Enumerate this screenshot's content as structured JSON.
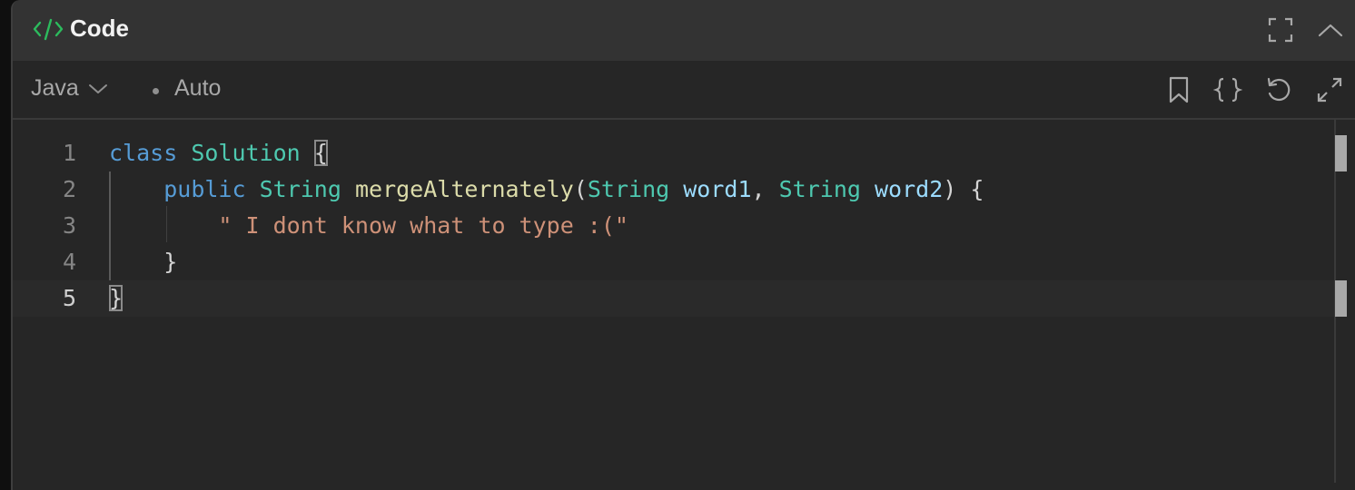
{
  "panel": {
    "title": "Code",
    "title_icon": "code-brackets-icon",
    "accent_color": "#2cbb5d",
    "actions": [
      {
        "name": "fullscreen-button",
        "icon": "fullscreen-corners-icon"
      },
      {
        "name": "collapse-button",
        "icon": "chevron-up-icon"
      }
    ]
  },
  "toolbar": {
    "language": "Java",
    "language_dropdown_icon": "chevron-down-icon",
    "mode": "Auto",
    "actions": [
      {
        "name": "bookmark-button",
        "icon": "bookmark-icon"
      },
      {
        "name": "format-code-button",
        "icon": "curly-braces-icon"
      },
      {
        "name": "reset-code-button",
        "icon": "undo-icon"
      },
      {
        "name": "expand-editor-button",
        "icon": "expand-arrows-icon"
      }
    ]
  },
  "editor": {
    "active_line": 5,
    "lines": [
      {
        "number": "1",
        "tokens": [
          {
            "t": "class",
            "c": "kw"
          },
          {
            "t": " ",
            "c": "pn"
          },
          {
            "t": "Solution",
            "c": "ty"
          },
          {
            "t": " ",
            "c": "pn"
          },
          {
            "t": "{",
            "c": "pn brk"
          }
        ]
      },
      {
        "number": "2",
        "tokens": [
          {
            "t": "    ",
            "c": "pn"
          },
          {
            "t": "public",
            "c": "kw"
          },
          {
            "t": " ",
            "c": "pn"
          },
          {
            "t": "String",
            "c": "ty"
          },
          {
            "t": " ",
            "c": "pn"
          },
          {
            "t": "mergeAlternately",
            "c": "fn"
          },
          {
            "t": "(",
            "c": "pn"
          },
          {
            "t": "String",
            "c": "ty"
          },
          {
            "t": " ",
            "c": "pn"
          },
          {
            "t": "word1",
            "c": "pr"
          },
          {
            "t": ", ",
            "c": "pn"
          },
          {
            "t": "String",
            "c": "ty"
          },
          {
            "t": " ",
            "c": "pn"
          },
          {
            "t": "word2",
            "c": "pr"
          },
          {
            "t": ") {",
            "c": "pn"
          }
        ]
      },
      {
        "number": "3",
        "tokens": [
          {
            "t": "        ",
            "c": "pn"
          },
          {
            "t": "\" I dont know what to type :(\"",
            "c": "st"
          }
        ]
      },
      {
        "number": "4",
        "tokens": [
          {
            "t": "    ",
            "c": "pn"
          },
          {
            "t": "}",
            "c": "pn"
          }
        ]
      },
      {
        "number": "5",
        "tokens": [
          {
            "t": "}",
            "c": "pn brk"
          }
        ]
      }
    ]
  }
}
